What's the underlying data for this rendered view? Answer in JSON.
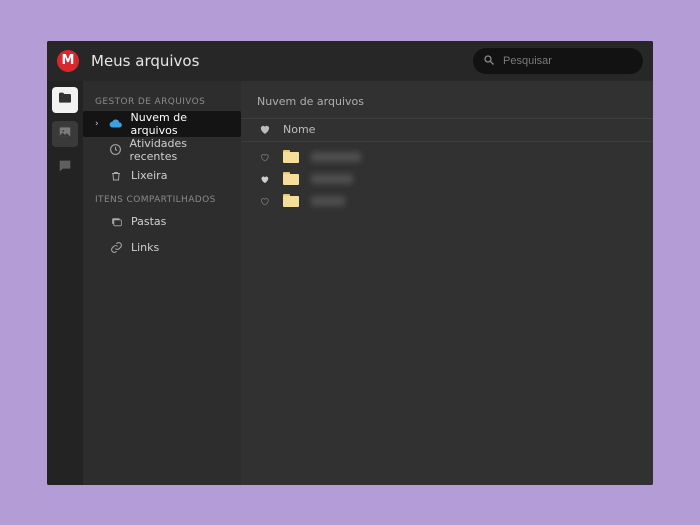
{
  "app": {
    "logo_letter": "M",
    "title": "Meus arquivos",
    "brand_color": "#d9272e"
  },
  "search": {
    "placeholder": "Pesquisar",
    "value": ""
  },
  "rail": {
    "items": [
      {
        "name": "files",
        "icon": "folder-icon",
        "active": true
      },
      {
        "name": "gallery",
        "icon": "image-icon",
        "active": false
      },
      {
        "name": "chat",
        "icon": "chat-icon",
        "active": false
      }
    ]
  },
  "sidebar": {
    "sections": [
      {
        "header": "GESTOR DE ARQUIVOS",
        "items": [
          {
            "label": "Nuvem de arquivos",
            "icon": "cloud-icon",
            "active": true,
            "expandable": true
          },
          {
            "label": "Atividades recentes",
            "icon": "clock-icon",
            "active": false,
            "expandable": false
          },
          {
            "label": "Lixeira",
            "icon": "trash-icon",
            "active": false,
            "expandable": false
          }
        ]
      },
      {
        "header": "ITENS COMPARTILHADOS",
        "items": [
          {
            "label": "Pastas",
            "icon": "folders-icon",
            "active": false,
            "expandable": false
          },
          {
            "label": "Links",
            "icon": "link-icon",
            "active": false,
            "expandable": false
          }
        ]
      }
    ]
  },
  "content": {
    "breadcrumb": "Nuvem de arquivos",
    "columns": {
      "favorite": "♥",
      "name": "Nome"
    },
    "rows": [
      {
        "favorited": false,
        "type": "folder",
        "name_redacted": true,
        "blur": "long"
      },
      {
        "favorited": true,
        "type": "folder",
        "name_redacted": true,
        "blur": "med"
      },
      {
        "favorited": false,
        "type": "folder",
        "name_redacted": true,
        "blur": "short"
      }
    ]
  },
  "colors": {
    "window_bg": "#272727",
    "sidebar_bg": "#2d2d2d",
    "content_bg": "#313131",
    "page_bg": "#b49dd6"
  }
}
